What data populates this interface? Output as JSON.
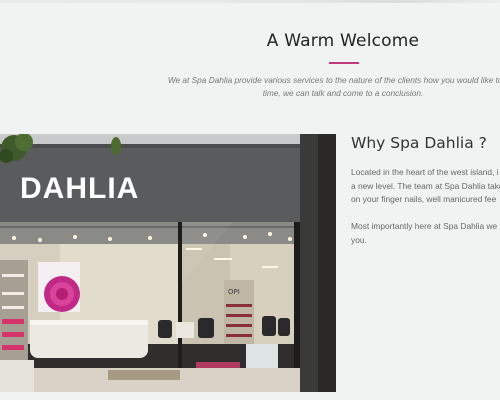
{
  "welcome": {
    "title": "A Warm Welcome",
    "lines": [
      "We at Spa Dahlia provide various services to the nature of the clients how you would like to spe",
      "time, we can talk and come to a conclusion."
    ]
  },
  "why": {
    "title": "Why Spa Dahlia ?",
    "para1": [
      "Located in the heart of the west island, i",
      "a new level. The team at Spa Dahlia take",
      "on your finger nails, well manicured fee"
    ],
    "para2": [
      "Most importantly here at Spa Dahlia we",
      "you."
    ]
  },
  "storefront": {
    "sign": "DAHLIA",
    "display_brand": "OPI"
  },
  "colors": {
    "accent": "#c0397a",
    "background": "#f1f3f2",
    "heading": "#222222",
    "body_text": "#666666"
  }
}
